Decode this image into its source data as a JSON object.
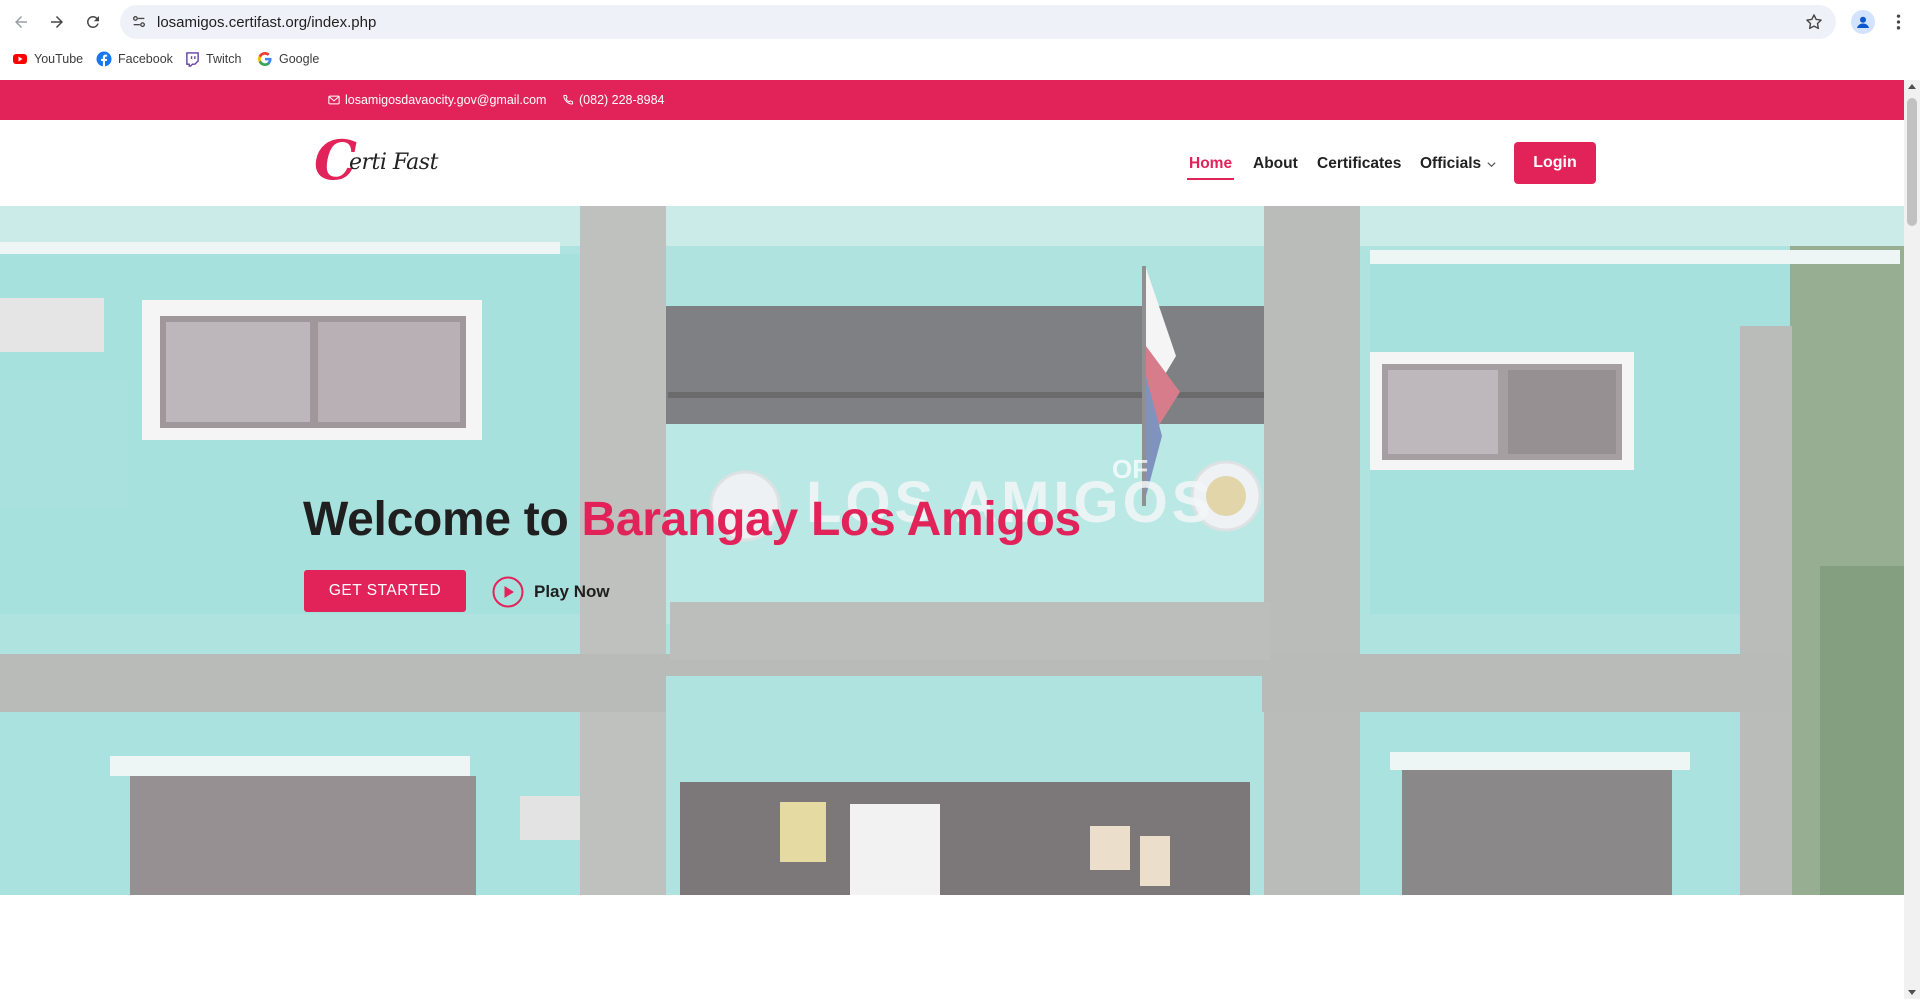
{
  "browser": {
    "url": "losamigos.certifast.org/index.php",
    "bookmarks": [
      {
        "label": "YouTube",
        "icon": "youtube-icon"
      },
      {
        "label": "Facebook",
        "icon": "facebook-icon"
      },
      {
        "label": "Twitch",
        "icon": "twitch-icon"
      },
      {
        "label": "Google",
        "icon": "google-icon"
      }
    ]
  },
  "topbar": {
    "email": "losamigosdavaocity.gov@gmail.com",
    "phone": "(082) 228-8984"
  },
  "header": {
    "logo": {
      "first_letter": "C",
      "rest": "erti Fast"
    },
    "nav": [
      {
        "label": "Home",
        "active": true
      },
      {
        "label": "About"
      },
      {
        "label": "Certificates"
      },
      {
        "label": "Officials",
        "dropdown": true
      }
    ],
    "login_label": "Login"
  },
  "hero": {
    "title_plain": "Welcome to ",
    "title_highlight": "Barangay Los Amigos",
    "sign_text": "LOS AMIGOS",
    "sign_small": "OF",
    "get_started_label": "GET STARTED",
    "play_label": "Play Now"
  },
  "colors": {
    "accent": "#e22359",
    "text_dark": "#1f1f1f",
    "building": "#78d4cf"
  }
}
